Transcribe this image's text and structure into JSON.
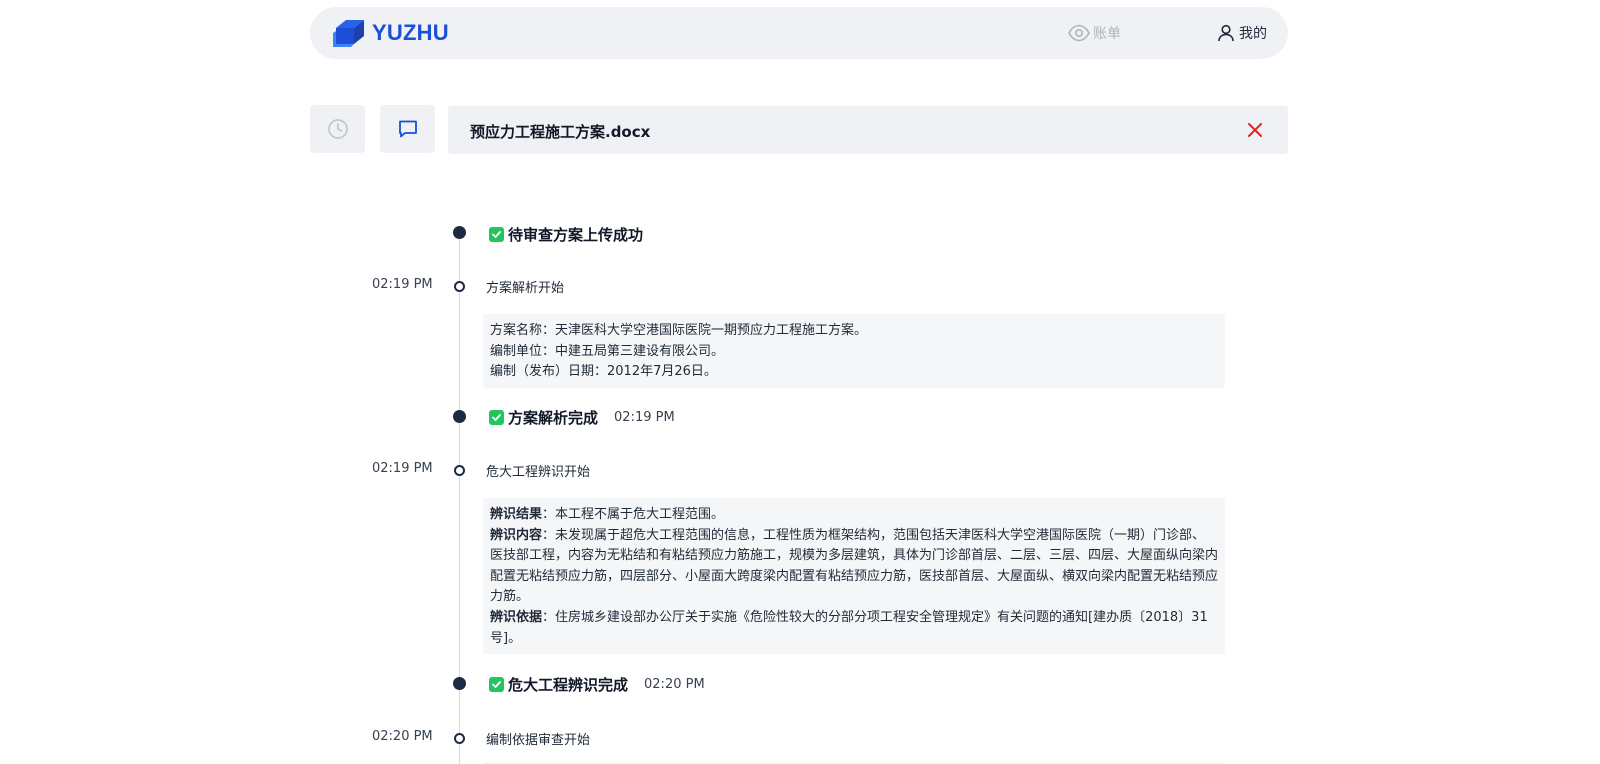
{
  "header": {
    "logo_text": "YUZHU",
    "nav_bill": "账单",
    "nav_mine": "我的"
  },
  "file": {
    "name": "预应力工程施工方案.docx"
  },
  "colors": {
    "brand": "#1d4ed8",
    "close": "#dc2626",
    "success": "#22c55e",
    "timeline_dot": "#1e2a44"
  },
  "timeline": {
    "m1": {
      "title": "待审查方案上传成功"
    },
    "s1": {
      "time": "02:19 PM",
      "title": "方案解析开始",
      "lines": [
        "方案名称：天津医科大学空港国际医院一期预应力工程施工方案。",
        "编制单位：中建五局第三建设有限公司。",
        "编制（发布）日期：2012年7月26日。"
      ]
    },
    "m2": {
      "title": "方案解析完成",
      "time": "02:19 PM"
    },
    "s2": {
      "time": "02:19 PM",
      "title": "危大工程辨识开始",
      "result_label": "辨识结果",
      "result_text": "：本工程不属于危大工程范围。",
      "content_label": "辨识内容",
      "content_text": "：未发现属于超危大工程范围的信息，工程性质为框架结构，范围包括天津医科大学空港国际医院（一期）门诊部、医技部工程，内容为无粘结和有粘结预应力筋施工，规模为多层建筑，具体为门诊部首层、二层、三层、四层、大屋面纵向梁内配置无粘结预应力筋，四层部分、小屋面大跨度梁内配置有粘结预应力筋，医技部首层、大屋面纵、横双向梁内配置无粘结预应力筋。",
      "basis_label": "辨识依据",
      "basis_text": "：住房城乡建设部办公厅关于实施《危险性较大的分部分项工程安全管理规定》有关问题的通知[建办质〔2018〕31号]。"
    },
    "m3": {
      "title": "危大工程辨识完成",
      "time": "02:20 PM"
    },
    "s3": {
      "time": "02:20 PM",
      "title": "编制依据审查开始"
    }
  }
}
